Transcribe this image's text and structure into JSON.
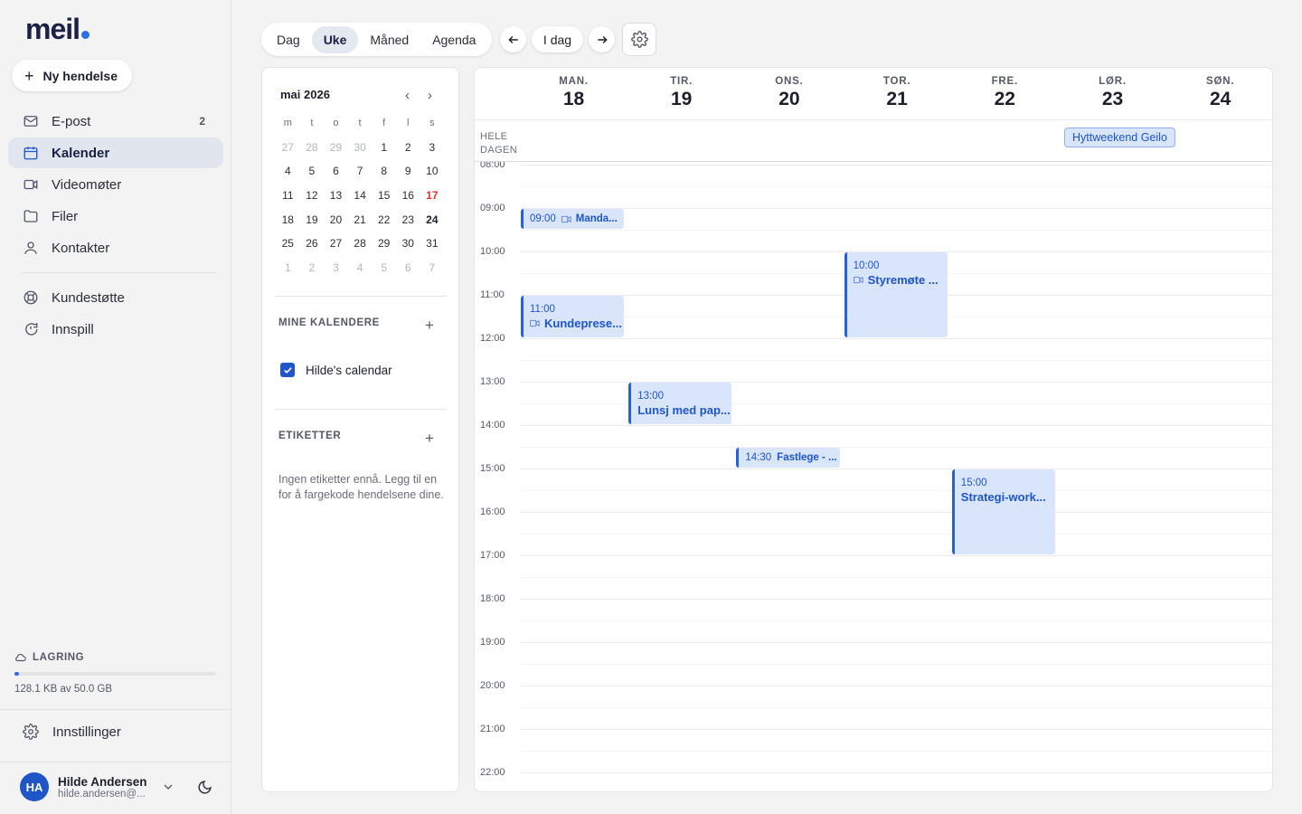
{
  "app": {
    "logo": "meil",
    "new_event_label": "Ny hendelse"
  },
  "sidebar": {
    "items": [
      {
        "label": "E-post",
        "icon": "mail-icon",
        "count": "2"
      },
      {
        "label": "Kalender",
        "icon": "calendar-icon",
        "active": true
      },
      {
        "label": "Videomøter",
        "icon": "video-icon"
      },
      {
        "label": "Filer",
        "icon": "folder-icon"
      },
      {
        "label": "Kontakter",
        "icon": "user-icon"
      }
    ],
    "secondary": [
      {
        "label": "Kundestøtte",
        "icon": "lifebuoy-icon"
      },
      {
        "label": "Innspill",
        "icon": "feedback-icon"
      }
    ],
    "storage": {
      "title": "LAGRING",
      "text": "128.1 KB av 50.0 GB",
      "used_fraction": 2.5e-06
    },
    "settings_label": "Innstillinger",
    "user": {
      "initials": "HA",
      "name": "Hilde Andersen",
      "email": "hilde.andersen@..."
    }
  },
  "toolbar": {
    "views": [
      "Dag",
      "Uke",
      "Måned",
      "Agenda"
    ],
    "active_view": "Uke",
    "today_label": "I dag"
  },
  "mini_calendar": {
    "title": "mai 2026",
    "weekdays": [
      "m",
      "t",
      "o",
      "t",
      "f",
      "l",
      "s"
    ],
    "weeks": [
      [
        "27",
        "28",
        "29",
        "30",
        "1",
        "2",
        "3"
      ],
      [
        "4",
        "5",
        "6",
        "7",
        "8",
        "9",
        "10"
      ],
      [
        "11",
        "12",
        "13",
        "14",
        "15",
        "16",
        "17"
      ],
      [
        "18",
        "19",
        "20",
        "21",
        "22",
        "23",
        "24"
      ],
      [
        "25",
        "26",
        "27",
        "28",
        "29",
        "30",
        "31"
      ],
      [
        "1",
        "2",
        "3",
        "4",
        "5",
        "6",
        "7"
      ]
    ],
    "today": "17",
    "selected": "24"
  },
  "panel": {
    "my_calendars_title": "MINE KALENDERE",
    "calendar_name": "Hilde's calendar",
    "tags_title": "ETIKETTER",
    "tags_empty": "Ingen etiketter ennå. Legg til en for å fargekode hendelsene dine."
  },
  "week": {
    "days": [
      {
        "name": "MAN.",
        "num": "18"
      },
      {
        "name": "TIR.",
        "num": "19"
      },
      {
        "name": "ONS.",
        "num": "20"
      },
      {
        "name": "TOR.",
        "num": "21"
      },
      {
        "name": "FRE.",
        "num": "22"
      },
      {
        "name": "LØR.",
        "num": "23"
      },
      {
        "name": "SØN.",
        "num": "24"
      }
    ],
    "allday_label_1": "HELE",
    "allday_label_2": "DAGEN",
    "allday_event": {
      "title": "Hyttweekend Geilo",
      "day": 5
    },
    "hours": [
      "08:00",
      "09:00",
      "10:00",
      "11:00",
      "12:00",
      "13:00",
      "14:00",
      "15:00",
      "16:00",
      "17:00",
      "18:00",
      "19:00",
      "20:00",
      "21:00",
      "22:00"
    ],
    "events": [
      {
        "time": "09:00",
        "title": "Manda...",
        "day": 0,
        "start": 9.0,
        "end": 9.5,
        "video": true
      },
      {
        "time": "11:00",
        "title": "Kundepresе...",
        "day": 0,
        "start": 11.0,
        "end": 12.0,
        "video": true
      },
      {
        "time": "10:00",
        "title": "Styremøte ...",
        "day": 3,
        "start": 10.0,
        "end": 12.0,
        "video": true
      },
      {
        "time": "13:00",
        "title": "Lunsj med pap...",
        "day": 1,
        "start": 13.0,
        "end": 14.0,
        "video": false
      },
      {
        "time": "14:30",
        "title": "Fastlege - ...",
        "day": 2,
        "start": 14.5,
        "end": 15.0,
        "video": false
      },
      {
        "time": "15:00",
        "title": "Strategi-work...",
        "day": 4,
        "start": 15.0,
        "end": 17.0,
        "video": false
      }
    ]
  },
  "colors": {
    "accent": "#2f6de1",
    "event_bg": "#d8e5fb",
    "event_border": "#2363d6",
    "today_red": "#e0322f"
  }
}
